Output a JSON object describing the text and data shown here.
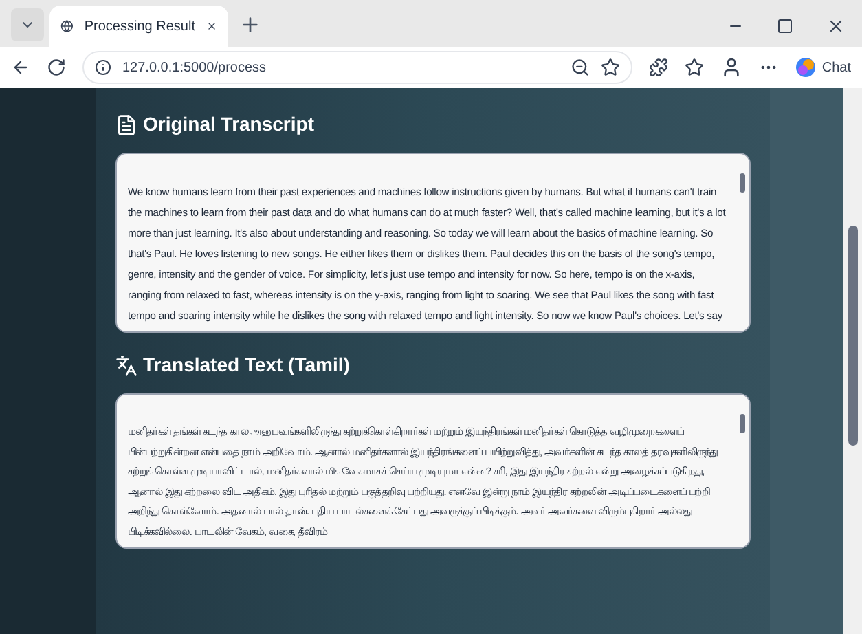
{
  "browser": {
    "tab_title": "Processing Result",
    "url": "127.0.0.1:5000/process",
    "chat_label": "Chat"
  },
  "sections": [
    {
      "kind": "document",
      "heading": "Original Transcript",
      "text": "We know humans learn from their past experiences and machines follow instructions given by humans. But what if humans can't train the machines to learn from their past data and do what humans can do at much faster? Well, that's called machine learning, but it's a lot more than just learning. It's also about understanding and reasoning. So today we will learn about the basics of machine learning. So that's Paul. He loves listening to new songs. He either likes them or dislikes them. Paul decides this on the basis of the song's tempo, genre, intensity and the gender of voice. For simplicity, let's just use tempo and intensity for now. So here, tempo is on the x-axis, ranging from relaxed to fast, whereas intensity is on the y-axis, ranging from light to soaring. We see that Paul likes the song with fast tempo and soaring intensity while he dislikes the song with relaxed tempo and light intensity. So now we know Paul's choices. Let's say"
    },
    {
      "kind": "translate",
      "heading": "Translated Text (Tamil)",
      "text": "மனிதர்கள் தங்கள் கடந்த கால அனுபவங்களிலிருந்து கற்றுக்கொள்கிறார்கள் மற்றும் இயந்திரங்கள் மனிதர்கள் கொடுத்த வழிமுறைகளைப் பின்பற்றுகின்றன என்பதை நாம் அறிவோம். ஆனால் மனிதர்களால் இயந்திரங்களைப் பயிற்றுவித்து, அவர்களின் கடந்த காலத் தரவுகளிலிருந்து கற்றுக் கொள்ள முடியாவிட்டால், மனிதர்களால் மிக வேகமாகச் செய்ய முடியுமா என்ன? சரி, இது இயந்திர கற்றல் என்று அழைக்கப்படுகிறது, ஆனால் இது கற்றலை விட அதிகம். இது புரிதல் மற்றும் பகுத்தறிவு பற்றியது. எனவே இன்று நாம் இயந்திர கற்றலின் அடிப்படைகளைப் பற்றி அறிந்து கொள்வோம். அதனால் பால் தான். புதிய பாடல்களைக் கேட்பது அவருக்குப் பிடிக்கும். அவர் அவர்களை விரும்புகிறார் அல்லது பிடிக்கவில்லை. பாடலின் வேகம், வகை, தீவிரம்"
    }
  ]
}
